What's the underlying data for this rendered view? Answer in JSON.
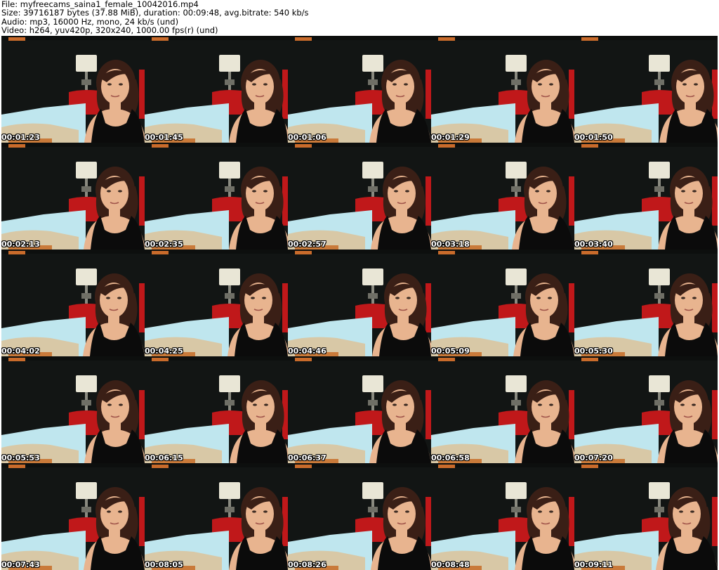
{
  "header": {
    "file_line": "File: myfreecams_saina1_female_10042016.mp4",
    "size_line": "Size: 39716187 bytes (37.88 MiB), duration: 00:09:48, avg.bitrate: 540 kb/s",
    "audio_line": "Audio: mp3, 16000 Hz, mono, 24 kb/s (und)",
    "video_line": "Video: h264, yuv420p, 320x240, 1000.00 fps(r) (und)"
  },
  "thumbnails": [
    {
      "timestamp": "00:01:23"
    },
    {
      "timestamp": "00:01:45"
    },
    {
      "timestamp": "00:01:06"
    },
    {
      "timestamp": "00:01:29"
    },
    {
      "timestamp": "00:01:50"
    },
    {
      "timestamp": "00:02:13"
    },
    {
      "timestamp": "00:02:35"
    },
    {
      "timestamp": "00:02:57"
    },
    {
      "timestamp": "00:03:18"
    },
    {
      "timestamp": "00:03:40"
    },
    {
      "timestamp": "00:04:02"
    },
    {
      "timestamp": "00:04:25"
    },
    {
      "timestamp": "00:04:46"
    },
    {
      "timestamp": "00:05:09"
    },
    {
      "timestamp": "00:05:30"
    },
    {
      "timestamp": "00:05:53"
    },
    {
      "timestamp": "00:06:15"
    },
    {
      "timestamp": "00:06:37"
    },
    {
      "timestamp": "00:06:58"
    },
    {
      "timestamp": "00:07:20"
    },
    {
      "timestamp": "00:07:43"
    },
    {
      "timestamp": "00:08:05"
    },
    {
      "timestamp": "00:08:26"
    },
    {
      "timestamp": "00:08:48"
    },
    {
      "timestamp": "00:09:11"
    }
  ],
  "colors": {
    "background_wall": "#121514",
    "lamp_shade": "#e9e6d6",
    "red_chair": "#c0181a",
    "bed_sheet": "#bfe6ee",
    "skin": "#e8b48f",
    "hair": "#3a1f16",
    "top": "#0b0b0b",
    "timestamp_text": "#ffffff"
  }
}
